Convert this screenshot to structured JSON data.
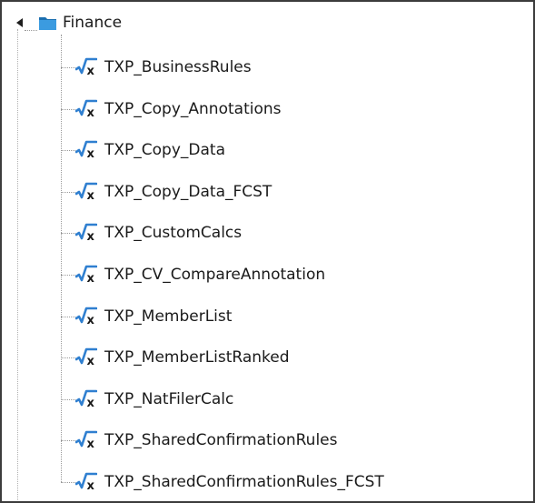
{
  "tree": {
    "root": {
      "label": "Finance",
      "icon": "folder-icon",
      "expanded": true
    },
    "items": [
      {
        "label": "TXP_BusinessRules",
        "icon": "business-rule-icon"
      },
      {
        "label": "TXP_Copy_Annotations",
        "icon": "business-rule-icon"
      },
      {
        "label": "TXP_Copy_Data",
        "icon": "business-rule-icon"
      },
      {
        "label": "TXP_Copy_Data_FCST",
        "icon": "business-rule-icon"
      },
      {
        "label": "TXP_CustomCalcs",
        "icon": "business-rule-icon"
      },
      {
        "label": "TXP_CV_CompareAnnotation",
        "icon": "business-rule-icon"
      },
      {
        "label": "TXP_MemberList",
        "icon": "business-rule-icon"
      },
      {
        "label": "TXP_MemberListRanked",
        "icon": "business-rule-icon"
      },
      {
        "label": "TXP_NatFilerCalc",
        "icon": "business-rule-icon"
      },
      {
        "label": "TXP_SharedConfirmationRules",
        "icon": "business-rule-icon"
      },
      {
        "label": "TXP_SharedConfirmationRules_FCST",
        "icon": "business-rule-icon"
      }
    ]
  },
  "colors": {
    "folder": "#2d8fd5",
    "folder_dark": "#1b6fb0",
    "rule_check": "#2f7fd0",
    "rule_x": "#1a1a1a",
    "text": "#1a1a1a",
    "border": "#3c3c3c"
  }
}
